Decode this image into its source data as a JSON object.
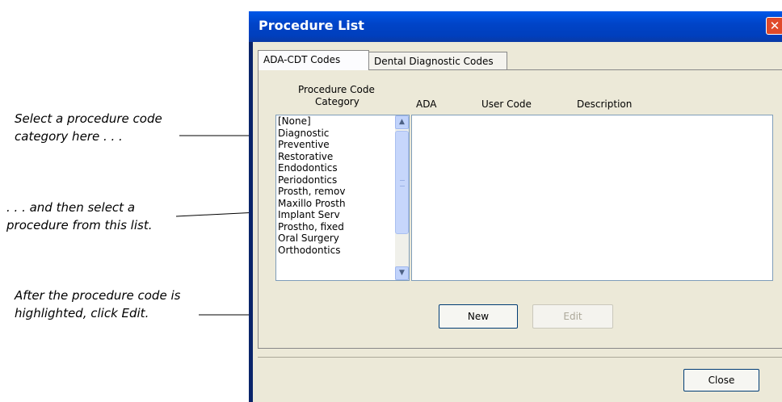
{
  "annotations": {
    "select_category": "Select a procedure code\ncategory here . . .",
    "select_procedure": ". . . and then select a\nprocedure from this list.",
    "click_edit": "After the procedure code is\nhighlighted, click Edit."
  },
  "window": {
    "title": "Procedure List",
    "close_glyph": "✕"
  },
  "tabs": [
    {
      "label": "ADA-CDT Codes",
      "active": true
    },
    {
      "label": "Dental Diagnostic Codes",
      "active": false
    }
  ],
  "category_list": {
    "label_line1": "Procedure Code",
    "label_line2": "Category",
    "items": [
      "[None]",
      "Diagnostic",
      "Preventive",
      "Restorative",
      "Endodontics",
      "Periodontics",
      "Prosth, remov",
      "Maxillo Prosth",
      "Implant Serv",
      "Prostho, fixed",
      "Oral Surgery",
      "Orthodontics"
    ]
  },
  "procedure_list": {
    "columns": [
      "ADA",
      "User Code",
      "Description"
    ]
  },
  "buttons": {
    "new": "New",
    "edit": "Edit",
    "close": "Close"
  },
  "icons": {
    "scroll_up": "▲",
    "scroll_down": "▼"
  }
}
